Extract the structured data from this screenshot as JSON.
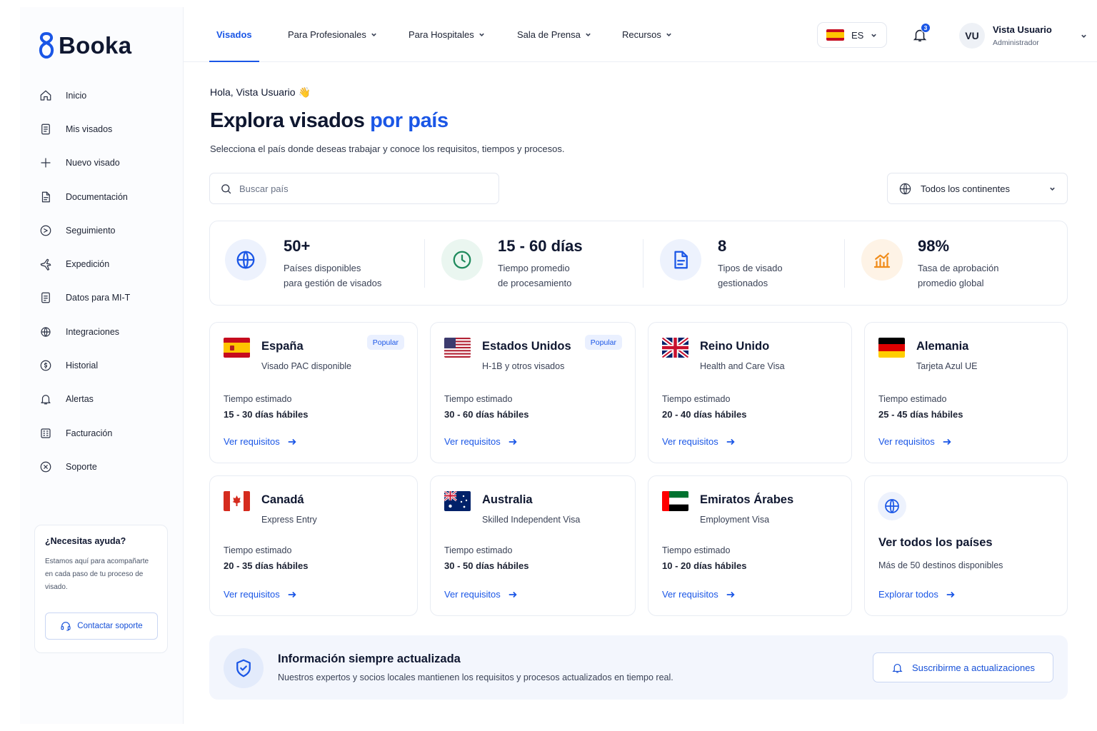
{
  "brand": {
    "name": "Booka",
    "accent": "#1a56e6"
  },
  "sidebar": {
    "items": [
      {
        "label": "Inicio",
        "icon": "home-icon"
      },
      {
        "label": "Mis visados",
        "icon": "document-icon"
      },
      {
        "label": "Nuevo visado",
        "icon": "plus-icon"
      },
      {
        "label": "Documentación",
        "icon": "file-icon"
      },
      {
        "label": "Seguimiento",
        "icon": "tracking-icon"
      },
      {
        "label": "Expedición",
        "icon": "plane-icon"
      },
      {
        "label": "Datos para MI-T",
        "icon": "data-icon"
      },
      {
        "label": "Integraciones",
        "icon": "integrations-icon"
      },
      {
        "label": "Historial",
        "icon": "history-icon"
      },
      {
        "label": "Alertas",
        "icon": "bell-icon"
      },
      {
        "label": "Facturación",
        "icon": "billing-icon"
      },
      {
        "label": "Soporte",
        "icon": "support-icon"
      }
    ],
    "help": {
      "title": "¿Necesitas ayuda?",
      "text": "Estamos aquí para acompañarte en cada paso de tu proceso de visado.",
      "button": "Contactar soporte"
    }
  },
  "header": {
    "tabs": [
      {
        "label": "Visados",
        "active": true
      },
      {
        "label": "Para Profesionales",
        "dropdown": true
      },
      {
        "label": "Para Hospitales",
        "dropdown": true
      },
      {
        "label": "Sala de Prensa",
        "dropdown": true
      },
      {
        "label": "Recursos",
        "dropdown": true
      }
    ],
    "language": "ES",
    "notifications_count": "3",
    "user": {
      "initials": "VU",
      "name": "Vista Usuario",
      "role": "Administrador"
    }
  },
  "main": {
    "greeting": "Hola, Vista Usuario 👋",
    "title_main": "Explora visados ",
    "title_accent": "por país",
    "subtitle": "Selecciona el país donde deseas trabajar y conoce los requisitos, tiempos y procesos.",
    "search_placeholder": "Buscar país",
    "continent_filter": "Todos los continentes",
    "stats": [
      {
        "value": "50+",
        "line1": "Países disponibles",
        "line2": "para gestión de visados",
        "icon": "globe-icon",
        "color": "#1a56e6",
        "bg": "#edf2fd"
      },
      {
        "value": "15 - 60 días",
        "line1": "Tiempo promedio",
        "line2": "de procesamiento",
        "icon": "clock-icon",
        "color": "#1e8a5c",
        "bg": "#eaf6f0"
      },
      {
        "value": "8",
        "line1": "Tipos de visado",
        "line2": "gestionados",
        "icon": "document-icon",
        "color": "#1a56e6",
        "bg": "#edf2fd"
      },
      {
        "value": "98%",
        "line1": "Tasa de aprobación",
        "line2": "promedio global",
        "icon": "chart-icon",
        "color": "#f08c1a",
        "bg": "#fef3e6"
      }
    ],
    "estimate_label": "Tiempo estimado",
    "requirements_link": "Ver requisitos",
    "countries": [
      {
        "name": "España",
        "subtitle": "Visado PAC disponible",
        "time": "15 - 30 días hábiles",
        "badge": "Popular",
        "flag": "es"
      },
      {
        "name": "Estados Unidos",
        "subtitle": "H-1B y otros visados",
        "time": "30 - 60 días hábiles",
        "badge": "Popular",
        "flag": "us"
      },
      {
        "name": "Reino Unido",
        "subtitle": "Health and Care Visa",
        "time": "20 - 40 días hábiles",
        "badge": "",
        "flag": "gb"
      },
      {
        "name": "Alemania",
        "subtitle": "Tarjeta Azul UE",
        "time": "25 - 45 días hábiles",
        "badge": "",
        "flag": "de"
      },
      {
        "name": "Canadá",
        "subtitle": "Express Entry",
        "time": "20 - 35 días hábiles",
        "badge": "",
        "flag": "ca"
      },
      {
        "name": "Australia",
        "subtitle": "Skilled Independent Visa",
        "time": "30 - 50 días hábiles",
        "badge": "",
        "flag": "au"
      },
      {
        "name": "Emiratos Árabes",
        "subtitle": "Employment Visa",
        "time": "10 - 20 días hábiles",
        "badge": "",
        "flag": "ae"
      }
    ],
    "all_countries": {
      "title": "Ver todos los países",
      "subtitle": "Más de 50 destinos disponibles",
      "link": "Explorar todos"
    },
    "info": {
      "title": "Información siempre actualizada",
      "text": "Nuestros expertos y socios locales mantienen los requisitos y procesos actualizados en tiempo real.",
      "button": "Suscribirme a actualizaciones"
    }
  }
}
